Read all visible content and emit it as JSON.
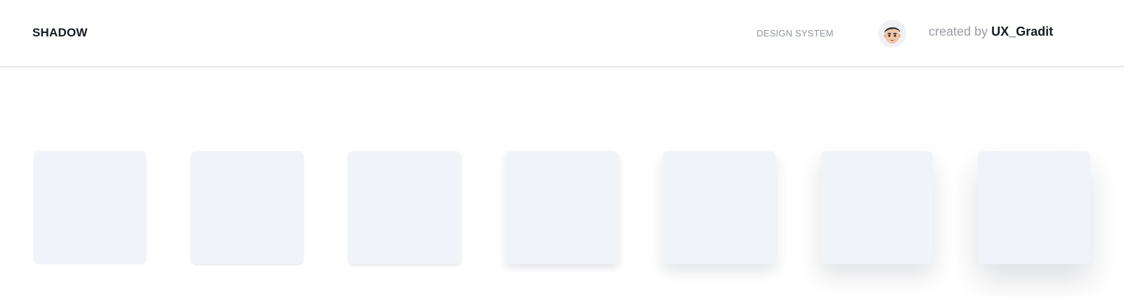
{
  "header": {
    "title": "SHADOW",
    "nav_link": "DESIGN SYSTEM",
    "avatar_icon": "memoji-avatar-icon",
    "credit_prefix": "created by",
    "credit_author": "UX_Gradit"
  },
  "colors": {
    "card_fill": "#f0f4f8",
    "title_text": "#171c24",
    "muted_text": "#9a9ea5"
  },
  "shadow_levels": [
    {
      "level": 1
    },
    {
      "level": 2
    },
    {
      "level": 3
    },
    {
      "level": 4
    },
    {
      "level": 5
    },
    {
      "level": 6
    },
    {
      "level": 7
    }
  ]
}
